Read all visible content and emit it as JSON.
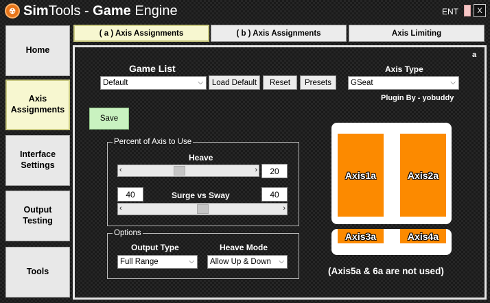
{
  "window": {
    "logo": "☢",
    "title_light": "Sim",
    "title_bold_1": "Tools",
    "title_sep": " - ",
    "title_bold_2": "Game",
    "title_rest": " Engine",
    "locale": "ENT",
    "close": "X"
  },
  "sidebar": {
    "items": [
      {
        "label": "Home"
      },
      {
        "label": "Axis Assignments"
      },
      {
        "label": "Interface Settings"
      },
      {
        "label": "Output Testing"
      },
      {
        "label": "Tools"
      }
    ],
    "active_index": 1
  },
  "tabs": [
    {
      "label": "( a ) Axis Assignments"
    },
    {
      "label": "( b ) Axis Assignments"
    },
    {
      "label": "Axis Limiting"
    }
  ],
  "panel": {
    "corner_label": "a",
    "game_list_label": "Game List",
    "game_list_value": "Default",
    "load_default": "Load Default",
    "reset": "Reset",
    "presets": "Presets",
    "axis_type_label": "Axis Type",
    "axis_type_value": "GSeat",
    "plugin_by": "Plugin By - yobuddy",
    "save": "Save"
  },
  "percent_group": {
    "title": "Percent of Axis to Use",
    "heave_label": "Heave",
    "heave_value": "20",
    "heave_fraction": 0.42,
    "surge_label": "Surge vs Sway",
    "surge_left": "40",
    "surge_right": "40",
    "surge_fraction": 0.5
  },
  "options_group": {
    "title": "Options",
    "output_type_label": "Output Type",
    "output_type_value": "Full Range",
    "heave_mode_label": "Heave Mode",
    "heave_mode_value": "Allow Up & Down"
  },
  "diagram": {
    "axis1": "Axis1a",
    "axis2": "Axis2a",
    "axis3": "Axis3a",
    "axis4": "Axis4a",
    "note": "(Axis5a & 6a are not used)",
    "axis_color": "#FC8A00"
  }
}
